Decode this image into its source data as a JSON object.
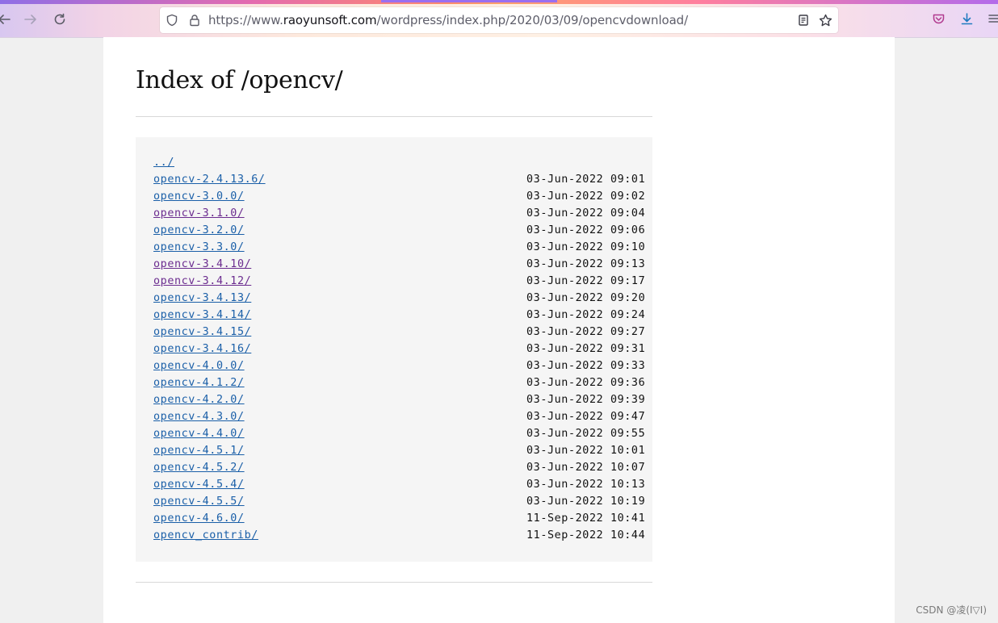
{
  "browser": {
    "url_prefix": "https://www.",
    "url_host": "raoyunsoft.com",
    "url_path": "/wordpress/index.php/2020/03/09/opencvdownload/",
    "icons": [
      "back-icon",
      "forward-icon",
      "reload-icon",
      "shield-icon",
      "lock-icon",
      "reader-view-icon",
      "bookmark-star-icon",
      "pocket-icon",
      "download-icon",
      "menu-icon"
    ]
  },
  "page": {
    "title": "Index of /opencv/",
    "parent_link": "../",
    "entries": [
      {
        "name": "opencv-2.4.13.6/",
        "date": "03-Jun-2022 09:01",
        "visited": false
      },
      {
        "name": "opencv-3.0.0/",
        "date": "03-Jun-2022 09:02",
        "visited": false
      },
      {
        "name": "opencv-3.1.0/",
        "date": "03-Jun-2022 09:04",
        "visited": true
      },
      {
        "name": "opencv-3.2.0/",
        "date": "03-Jun-2022 09:06",
        "visited": false
      },
      {
        "name": "opencv-3.3.0/",
        "date": "03-Jun-2022 09:10",
        "visited": false
      },
      {
        "name": "opencv-3.4.10/",
        "date": "03-Jun-2022 09:13",
        "visited": true
      },
      {
        "name": "opencv-3.4.12/",
        "date": "03-Jun-2022 09:17",
        "visited": true
      },
      {
        "name": "opencv-3.4.13/",
        "date": "03-Jun-2022 09:20",
        "visited": false
      },
      {
        "name": "opencv-3.4.14/",
        "date": "03-Jun-2022 09:24",
        "visited": false
      },
      {
        "name": "opencv-3.4.15/",
        "date": "03-Jun-2022 09:27",
        "visited": false
      },
      {
        "name": "opencv-3.4.16/",
        "date": "03-Jun-2022 09:31",
        "visited": false
      },
      {
        "name": "opencv-4.0.0/",
        "date": "03-Jun-2022 09:33",
        "visited": false
      },
      {
        "name": "opencv-4.1.2/",
        "date": "03-Jun-2022 09:36",
        "visited": false
      },
      {
        "name": "opencv-4.2.0/",
        "date": "03-Jun-2022 09:39",
        "visited": false
      },
      {
        "name": "opencv-4.3.0/",
        "date": "03-Jun-2022 09:47",
        "visited": false
      },
      {
        "name": "opencv-4.4.0/",
        "date": "03-Jun-2022 09:55",
        "visited": false
      },
      {
        "name": "opencv-4.5.1/",
        "date": "03-Jun-2022 10:01",
        "visited": false
      },
      {
        "name": "opencv-4.5.2/",
        "date": "03-Jun-2022 10:07",
        "visited": false
      },
      {
        "name": "opencv-4.5.4/",
        "date": "03-Jun-2022 10:13",
        "visited": false
      },
      {
        "name": "opencv-4.5.5/",
        "date": "03-Jun-2022 10:19",
        "visited": false
      },
      {
        "name": "opencv-4.6.0/",
        "date": "11-Sep-2022 10:41",
        "visited": false
      },
      {
        "name": "opencv_contrib/",
        "date": "11-Sep-2022 10:44",
        "visited": false
      }
    ]
  },
  "colors": {
    "link": "#1a5fa8",
    "visited_link": "#6b2c8f"
  },
  "watermark": "CSDN @凌(Ⅰ▽Ⅰ)"
}
